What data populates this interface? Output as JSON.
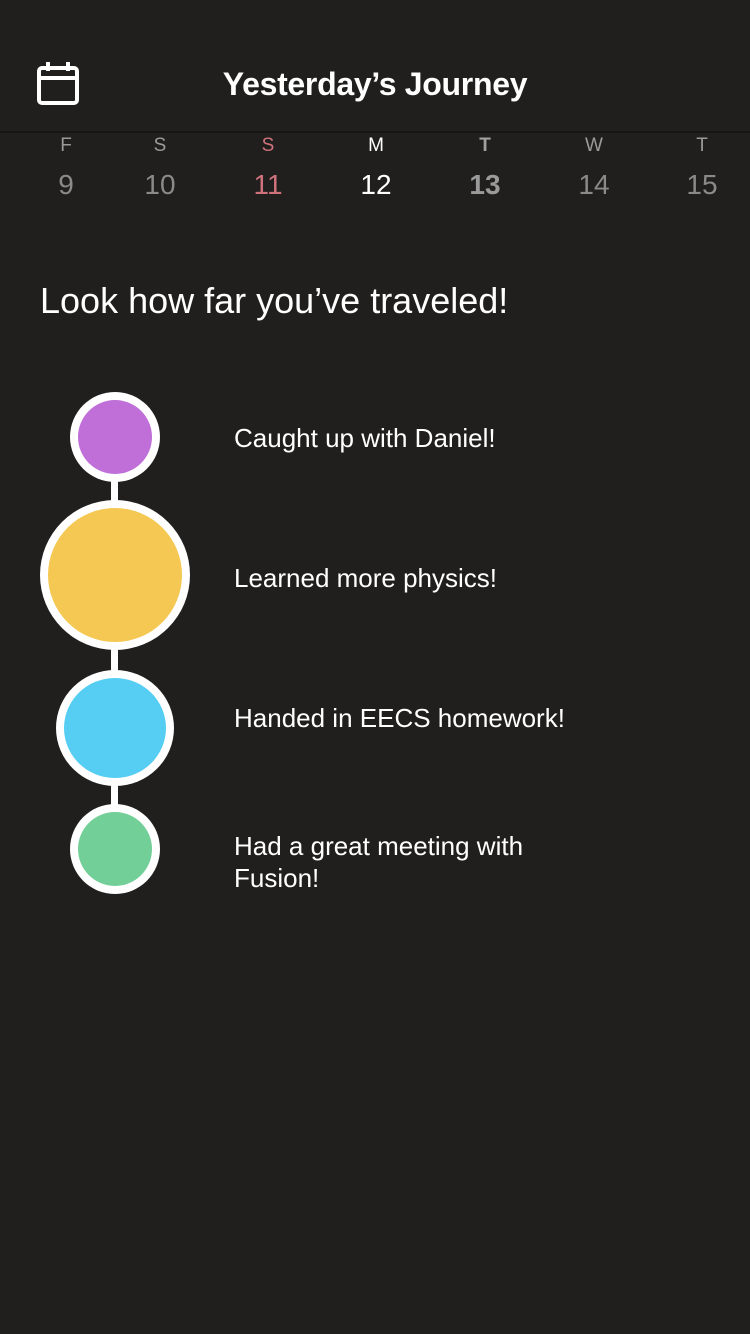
{
  "header": {
    "title": "Yesterday’s Journey",
    "calendar_icon": "calendar-icon"
  },
  "week": [
    {
      "letter": "F",
      "num": "9"
    },
    {
      "letter": "S",
      "num": "10"
    },
    {
      "letter": "S",
      "num": "11"
    },
    {
      "letter": "M",
      "num": "12"
    },
    {
      "letter": "T",
      "num": "13"
    },
    {
      "letter": "W",
      "num": "14"
    },
    {
      "letter": "T",
      "num": "15"
    }
  ],
  "headline": "Look how far you’ve traveled!",
  "events": [
    {
      "label": "Caught up with Daniel!",
      "color": "#c06fd8"
    },
    {
      "label": "Learned more physics!",
      "color": "#f4c852"
    },
    {
      "label": "Handed in EECS homework!",
      "color": "#56cdf3"
    },
    {
      "label": "Had a great meeting with Fusion!",
      "color": "#73cf98"
    }
  ],
  "colors": {
    "background": "#201f1e",
    "weekend_accent": "#d0727c"
  }
}
